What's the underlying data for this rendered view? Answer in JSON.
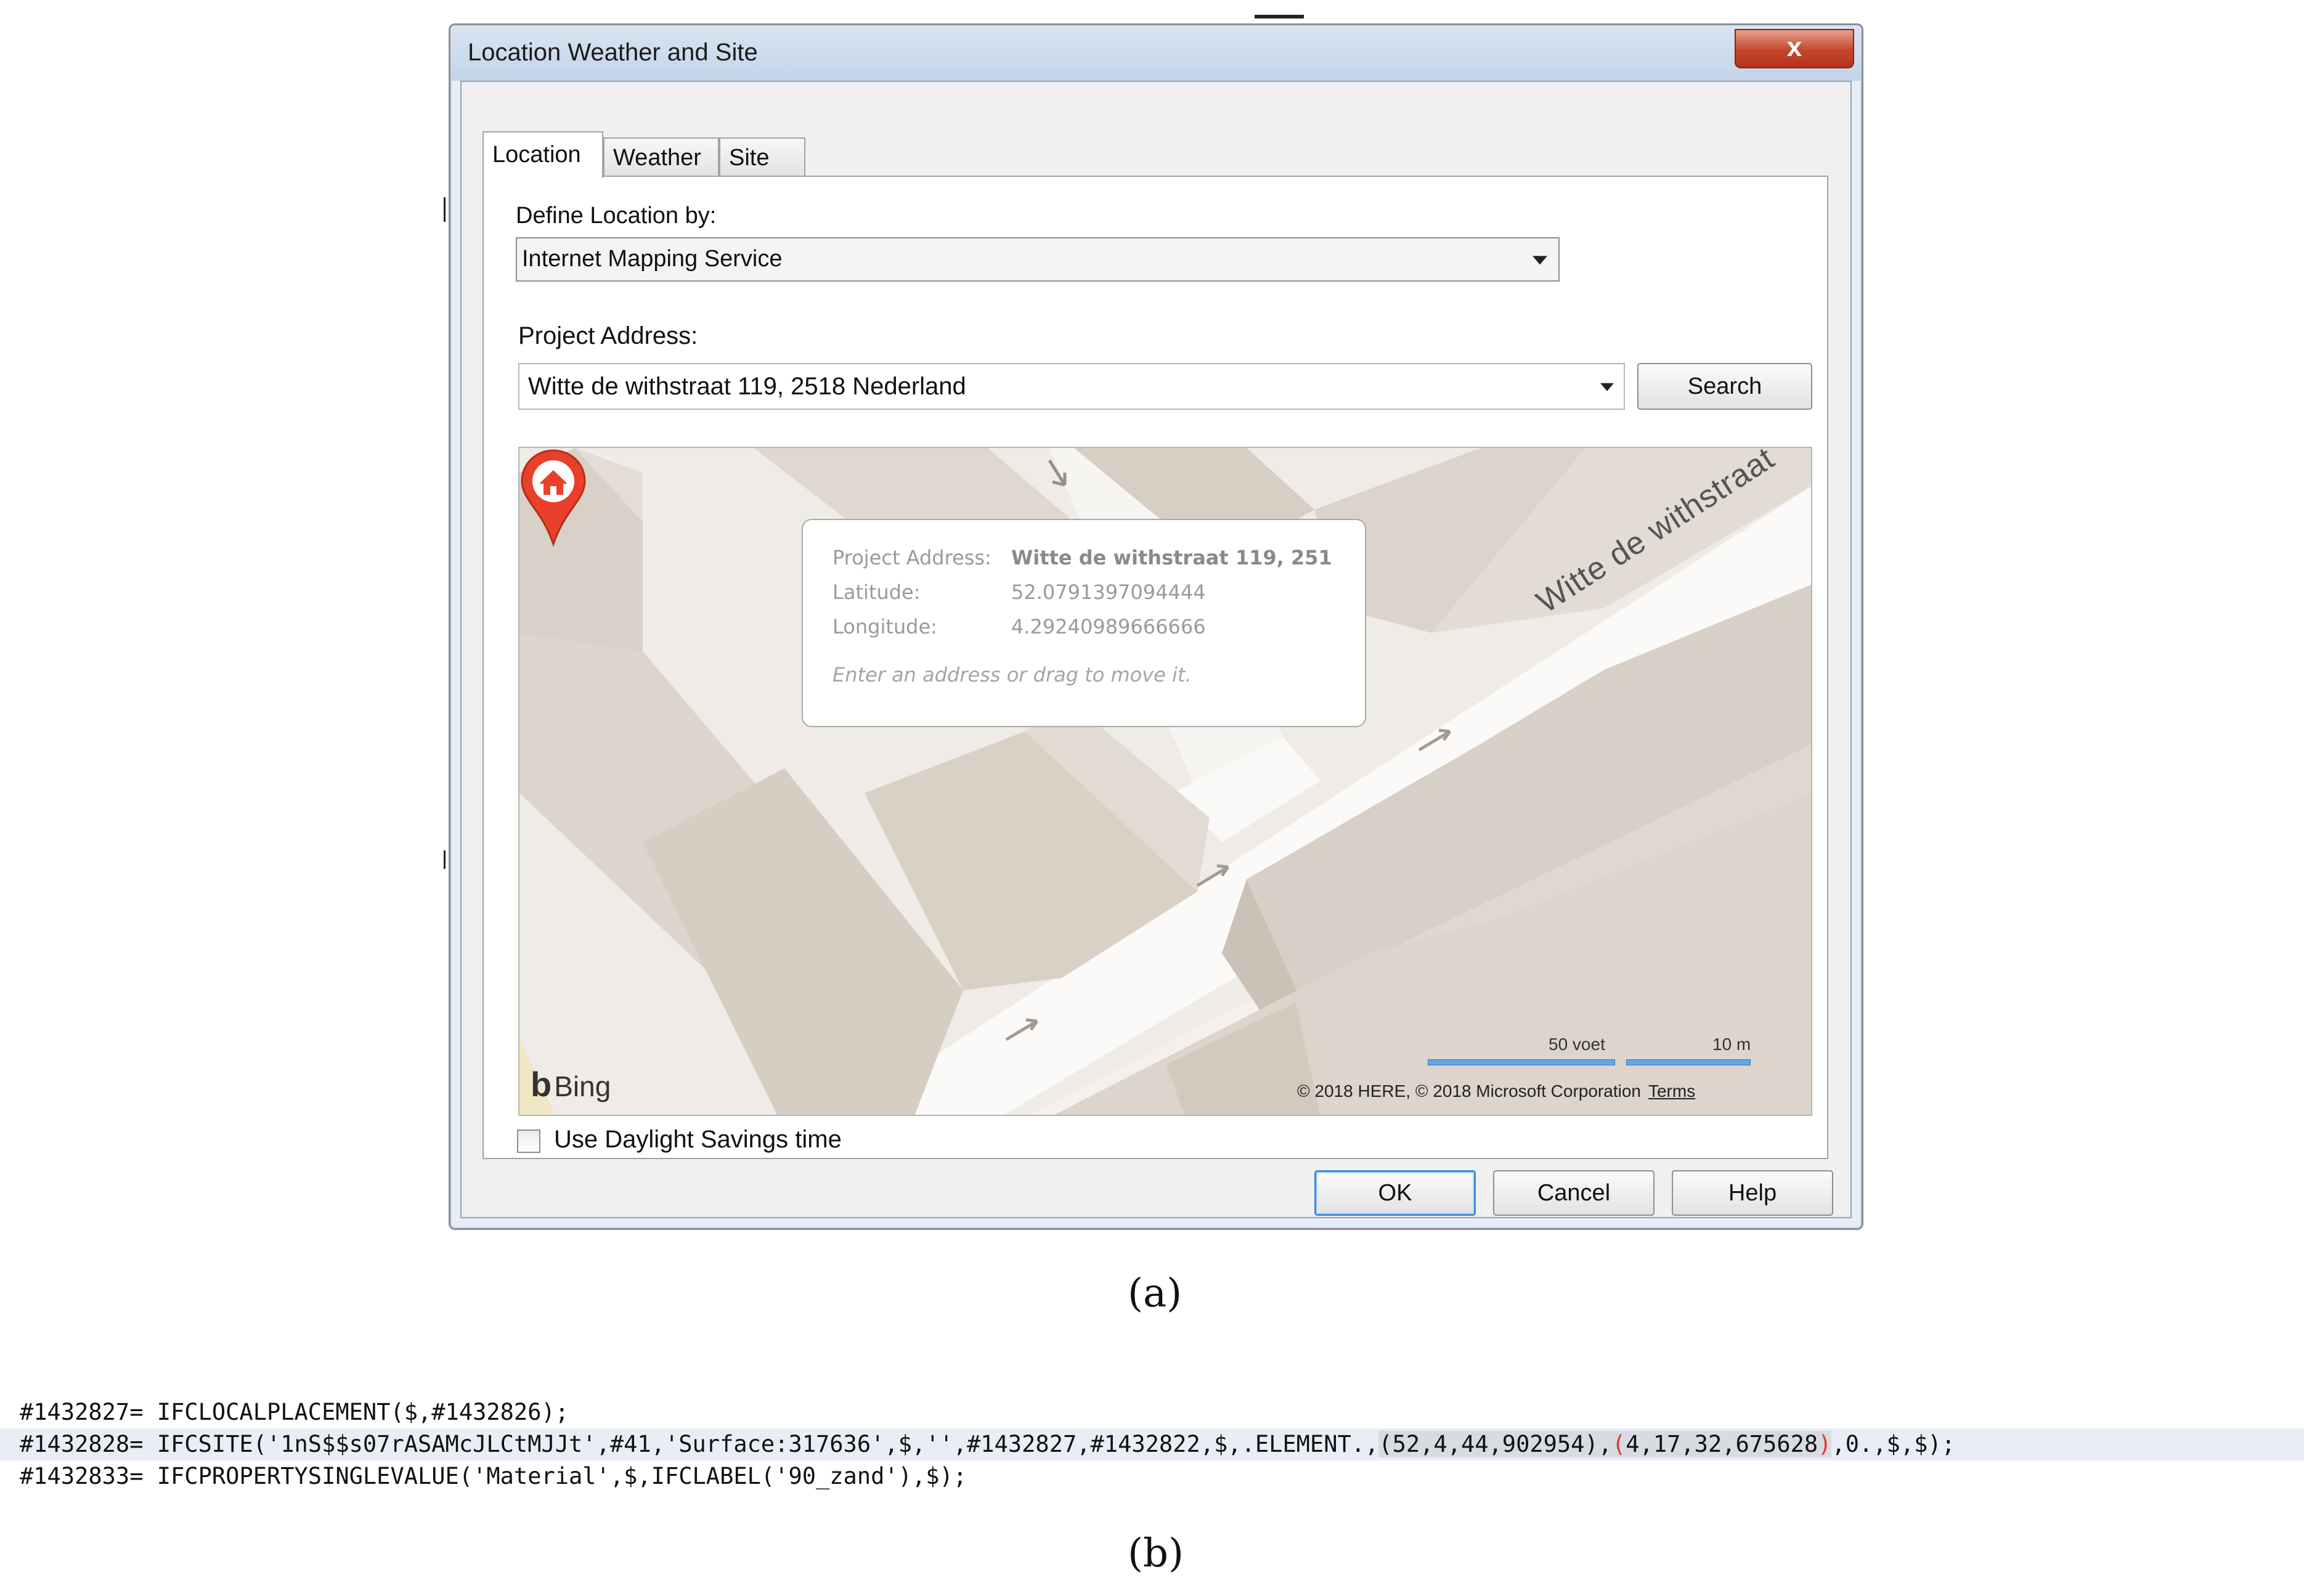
{
  "dialog": {
    "title": "Location Weather and Site",
    "close_label": "x",
    "tabs": [
      {
        "label": "Location"
      },
      {
        "label": "Weather"
      },
      {
        "label": "Site"
      }
    ],
    "define_location_label": "Define Location by:",
    "define_location_value": "Internet Mapping Service",
    "project_address_label": "Project Address:",
    "project_address_value": "Witte de withstraat 119, 2518 Nederland",
    "search_label": "Search",
    "map": {
      "bubble": {
        "address_key": "Project Address:",
        "address_value": "Witte de withstraat 119, 251",
        "lat_key": "Latitude:",
        "lat_value": "52.0791397094444",
        "lon_key": "Longitude:",
        "lon_value": "4.29240989666666",
        "hint": "Enter an address or drag to move it."
      },
      "street_name": "Witte de withstraat",
      "bing_label": "Bing",
      "scale_feet": "50 voet",
      "scale_meters": "10 m",
      "copyright": "© 2018 HERE, © 2018 Microsoft Corporation",
      "terms": "Terms"
    },
    "daylight_label": "Use Daylight Savings time",
    "daylight_checked": false,
    "ok_label": "OK",
    "cancel_label": "Cancel",
    "help_label": "Help"
  },
  "captions": {
    "a": "(a)",
    "b": "(b)"
  },
  "code": {
    "line1": "#1432827= IFCLOCALPLACEMENT($,#1432826);",
    "line2_prefix": "#1432828= IFCSITE('1nS$$s07rASAMcJLCtMJJt',#41,'Surface:317636',$,'',#1432827,#1432822,$,.ELEMENT.,",
    "line2_lat": "(52,4,44,902954)",
    "line2_sep": ",",
    "line2_lon_open": "(",
    "line2_lon": "4,17,32,675628",
    "line2_lon_close": ")",
    "line2_suffix": ",0.,$,$);",
    "line3": "#1432833= IFCPROPERTYSINGLEVALUE('Material',$,IFCLABEL('90_zand'),$);"
  }
}
